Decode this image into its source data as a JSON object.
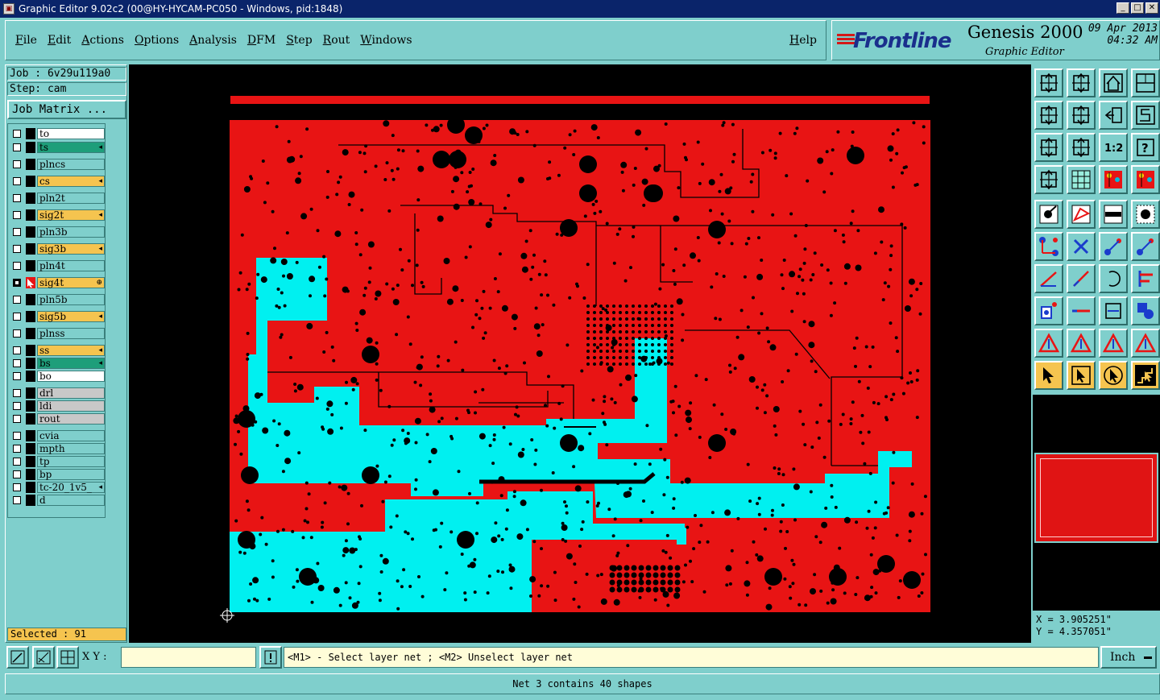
{
  "window": {
    "title": "Graphic Editor 9.02c2 (00@HY-HYCAM-PC050 - Windows, pid:1848)",
    "buttons": [
      "_",
      "□",
      "✕"
    ]
  },
  "menu": {
    "items": [
      "File",
      "Edit",
      "Actions",
      "Options",
      "Analysis",
      "DFM",
      "Step",
      "Rout",
      "Windows"
    ],
    "help": "Help"
  },
  "brand": {
    "logo": "Frontline",
    "product": "Genesis 2000",
    "subtitle": "Graphic Editor",
    "date": "09 Apr 2013",
    "time": "04:32 AM"
  },
  "job": {
    "job_label": "Job : 6v29u119a0",
    "step_label": "Step: cam",
    "matrix_button": "Job Matrix ..."
  },
  "layers": [
    {
      "name": "to",
      "color": "#ffffff",
      "state": "off",
      "mark": ""
    },
    {
      "name": "ts",
      "color": "#1e9e7a",
      "state": "off",
      "mark": "◂"
    },
    {
      "name": "plncs",
      "color": "#7fcfcc",
      "state": "off",
      "mark": ""
    },
    {
      "name": "cs",
      "color": "#f5c44f",
      "state": "off",
      "mark": "◂"
    },
    {
      "name": "pln2t",
      "color": "#7fcfcc",
      "state": "off",
      "mark": ""
    },
    {
      "name": "sig2t",
      "color": "#f5c44f",
      "state": "off",
      "mark": "◂"
    },
    {
      "name": "pln3b",
      "color": "#7fcfcc",
      "state": "off",
      "mark": ""
    },
    {
      "name": "sig3b",
      "color": "#f5c44f",
      "state": "off",
      "mark": "◂"
    },
    {
      "name": "pln4t",
      "color": "#7fcfcc",
      "state": "off",
      "mark": ""
    },
    {
      "name": "sig4t",
      "color": "#f5c44f",
      "state": "on",
      "mark": "⊕"
    },
    {
      "name": "pln5b",
      "color": "#7fcfcc",
      "state": "off",
      "mark": ""
    },
    {
      "name": "sig5b",
      "color": "#f5c44f",
      "state": "off",
      "mark": "◂"
    },
    {
      "name": "plnss",
      "color": "#7fcfcc",
      "state": "off",
      "mark": ""
    },
    {
      "name": "ss",
      "color": "#f5c44f",
      "state": "off",
      "mark": "◂"
    },
    {
      "name": "bs",
      "color": "#1e9e7a",
      "state": "off",
      "mark": "◂"
    },
    {
      "name": "bo",
      "color": "#ffffff",
      "state": "off",
      "mark": ""
    },
    {
      "name": "drl",
      "color": "#c8c8c8",
      "state": "off",
      "mark": ""
    },
    {
      "name": "ldi",
      "color": "#c8c8c8",
      "state": "off",
      "mark": ""
    },
    {
      "name": "rout",
      "color": "#c8c8c8",
      "state": "off",
      "mark": ""
    },
    {
      "name": "cvia",
      "color": "#7fcfcc",
      "state": "off",
      "mark": ""
    },
    {
      "name": "mpth",
      "color": "#7fcfcc",
      "state": "off",
      "mark": ""
    },
    {
      "name": "tp",
      "color": "#7fcfcc",
      "state": "off",
      "mark": ""
    },
    {
      "name": "bp",
      "color": "#7fcfcc",
      "state": "off",
      "mark": ""
    },
    {
      "name": "tc-20_1v5_",
      "color": "#7fcfcc",
      "state": "off",
      "mark": "◂"
    },
    {
      "name": "d",
      "color": "#7fcfcc",
      "state": "off",
      "mark": ""
    }
  ],
  "selected": "Selected : 91",
  "coords": {
    "x": "X = 3.905251\"",
    "y": "Y = 4.357051\""
  },
  "bottom": {
    "xy_label": "X Y :",
    "xy_value": "",
    "prompt": "<M1> - Select layer net ; <M2> Unselect layer net",
    "unit": "Inch"
  },
  "status": "Net 3 contains 40 shapes",
  "tool_labels": {
    "ratio": "1:2",
    "help": "?"
  },
  "colors": {
    "board_red": "#e81414",
    "net_cyan": "#00f0f0",
    "panel": "#7fcfcc",
    "highlight": "#f5c44f"
  }
}
